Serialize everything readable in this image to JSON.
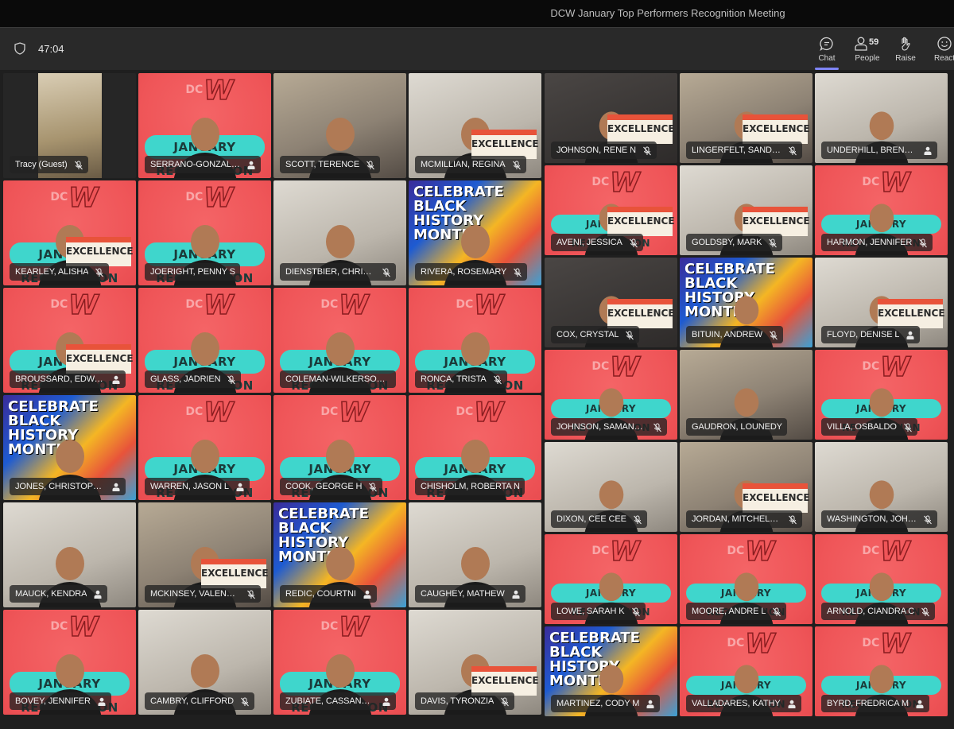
{
  "meeting": {
    "title": "DCW January Top Performers Recognition Meeting",
    "elapsed": "47:04"
  },
  "toolbar": {
    "chat": {
      "label": "Chat",
      "icon": "chat-icon",
      "active": true
    },
    "people": {
      "label": "People",
      "icon": "people-icon",
      "count": "59"
    },
    "raise": {
      "label": "Raise",
      "icon": "raise-hand-icon"
    },
    "react": {
      "label": "React",
      "icon": "react-smiley-icon"
    }
  },
  "brand_backdrop": {
    "logo_dc": "DC",
    "logo_w": "W",
    "banner": "JANUARY RECOGNITION",
    "sign": "EXCELLENCE",
    "bhm": "CELEBRATE BLACK HISTORY MONTH",
    "colors": {
      "brand_red": "#ef5558",
      "banner_teal": "#3fd6cc",
      "active_tab": "#7f85f5"
    }
  },
  "participants_left": [
    {
      "name": "Tracy (Guest)",
      "status": "muted",
      "bg": "guest"
    },
    {
      "name": "SERRANO-GONZALEZ...",
      "status": "speaker",
      "bg": "brand"
    },
    {
      "name": "SCOTT, TERENCE",
      "status": "muted",
      "bg": "room"
    },
    {
      "name": "MCMILLIAN, REGINA",
      "status": "muted",
      "bg": "light",
      "sign": true
    },
    {
      "name": "KEARLEY, ALISHA",
      "status": "muted",
      "bg": "brand",
      "sign": true
    },
    {
      "name": "JOERIGHT, PENNY S",
      "status": "none",
      "bg": "brand"
    },
    {
      "name": "DIENSTBIER, CHRISAN...",
      "status": "muted",
      "bg": "light"
    },
    {
      "name": "RIVERA, ROSEMARY",
      "status": "muted",
      "bg": "bhm"
    },
    {
      "name": "BROUSSARD, EDWARD",
      "status": "speaker",
      "bg": "brand",
      "sign": true
    },
    {
      "name": "GLASS, JADRIEN",
      "status": "muted",
      "bg": "brand"
    },
    {
      "name": "COLEMAN-WILKERSON, D...",
      "status": "none",
      "bg": "brand"
    },
    {
      "name": "RONCA, TRISTA",
      "status": "muted",
      "bg": "brand"
    },
    {
      "name": "JONES, CHRISTOPHER",
      "status": "speaker",
      "bg": "bhm"
    },
    {
      "name": "WARREN, JASON L",
      "status": "speaker",
      "bg": "brand"
    },
    {
      "name": "COOK, GEORGE H",
      "status": "muted",
      "bg": "brand"
    },
    {
      "name": "CHISHOLM, ROBERTA N",
      "status": "none",
      "bg": "brand"
    },
    {
      "name": "MAUCK, KENDRA",
      "status": "speaker",
      "bg": "light"
    },
    {
      "name": "MCKINSEY, VALENCIA",
      "status": "muted",
      "bg": "room",
      "sign": true
    },
    {
      "name": "REDIC, COURTNI",
      "status": "speaker",
      "bg": "bhm"
    },
    {
      "name": "CAUGHEY, MATHEW",
      "status": "speaker",
      "bg": "light"
    },
    {
      "name": "BOVEY, JENNIFER",
      "status": "speaker",
      "bg": "brand"
    },
    {
      "name": "CAMBRY, CLIFFORD",
      "status": "muted",
      "bg": "light"
    },
    {
      "name": "ZUBIATE, CASSANDR...",
      "status": "speaker",
      "bg": "brand"
    },
    {
      "name": "DAVIS, TYRONZIA",
      "status": "muted",
      "bg": "light",
      "sign": true
    }
  ],
  "participants_right": [
    {
      "name": "JOHNSON, RENE N",
      "status": "muted",
      "bg": "dark",
      "sign": true
    },
    {
      "name": "LINGERFELT, SANDRA",
      "status": "muted",
      "bg": "room",
      "sign": true
    },
    {
      "name": "UNDERHILL, BRENT D",
      "status": "speaker",
      "bg": "light"
    },
    {
      "name": "AVENI, JESSICA",
      "status": "muted",
      "bg": "brand",
      "sign": true
    },
    {
      "name": "GOLDSBY, MARK",
      "status": "muted",
      "bg": "light",
      "sign": true
    },
    {
      "name": "HARMON, JENNIFER",
      "status": "muted",
      "bg": "brand"
    },
    {
      "name": "COX, CRYSTAL",
      "status": "muted",
      "bg": "dark",
      "sign": true
    },
    {
      "name": "BITUIN, ANDREW",
      "status": "muted",
      "bg": "bhm"
    },
    {
      "name": "FLOYD, DENISE L",
      "status": "speaker",
      "bg": "light",
      "sign": true
    },
    {
      "name": "JOHNSON, SAMANTH...",
      "status": "muted",
      "bg": "brand"
    },
    {
      "name": "GAUDRON, LOUNEDY",
      "status": "none",
      "bg": "room"
    },
    {
      "name": "VILLA, OSBALDO",
      "status": "muted",
      "bg": "brand"
    },
    {
      "name": "DIXON, CEE CEE",
      "status": "muted",
      "bg": "light"
    },
    {
      "name": "JORDAN, MITCHELL M",
      "status": "muted",
      "bg": "room",
      "sign": true
    },
    {
      "name": "WASHINGTON, JOHN I",
      "status": "muted",
      "bg": "light"
    },
    {
      "name": "LOWE, SARAH K",
      "status": "muted",
      "bg": "brand"
    },
    {
      "name": "MOORE, ANDRE L",
      "status": "muted",
      "bg": "brand"
    },
    {
      "name": "ARNOLD, CIANDRA C",
      "status": "muted",
      "bg": "brand"
    },
    {
      "name": "MARTINEZ, CODY M",
      "status": "speaker",
      "bg": "bhm"
    },
    {
      "name": "VALLADARES, KATHY",
      "status": "speaker",
      "bg": "brand"
    },
    {
      "name": "BYRD, FREDRICA M",
      "status": "speaker",
      "bg": "brand"
    }
  ]
}
